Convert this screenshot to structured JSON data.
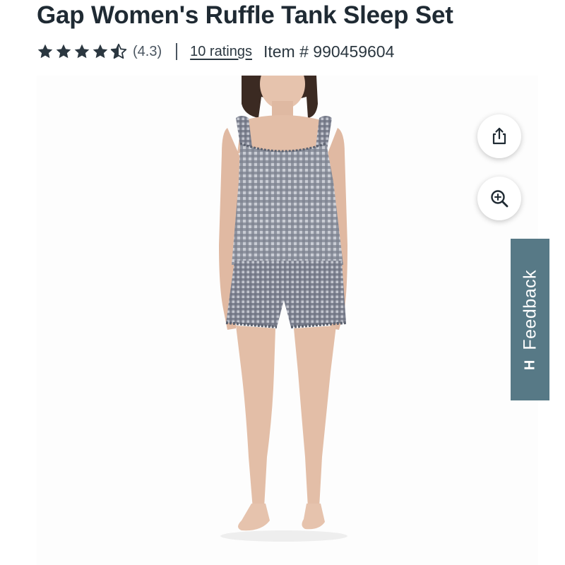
{
  "product": {
    "title": "Gap Women's Ruffle Tank Sleep Set",
    "rating": {
      "stars": 4.3,
      "value_text": "(4.3)",
      "ratings_link": "10 ratings"
    },
    "item_number": "Item # 990459604"
  },
  "image": {
    "subject": "model-wearing-gingham-ruffle-tank-and-shorts"
  },
  "actions": {
    "share_icon": "share-icon",
    "zoom_icon": "zoom-in-icon"
  },
  "feedback": {
    "label": "Feedback",
    "logo_text": "H"
  },
  "colors": {
    "title": "#1f2a33",
    "star": "#2b3740",
    "feedback_bg": "#577986",
    "gingham": "#5c6270"
  }
}
